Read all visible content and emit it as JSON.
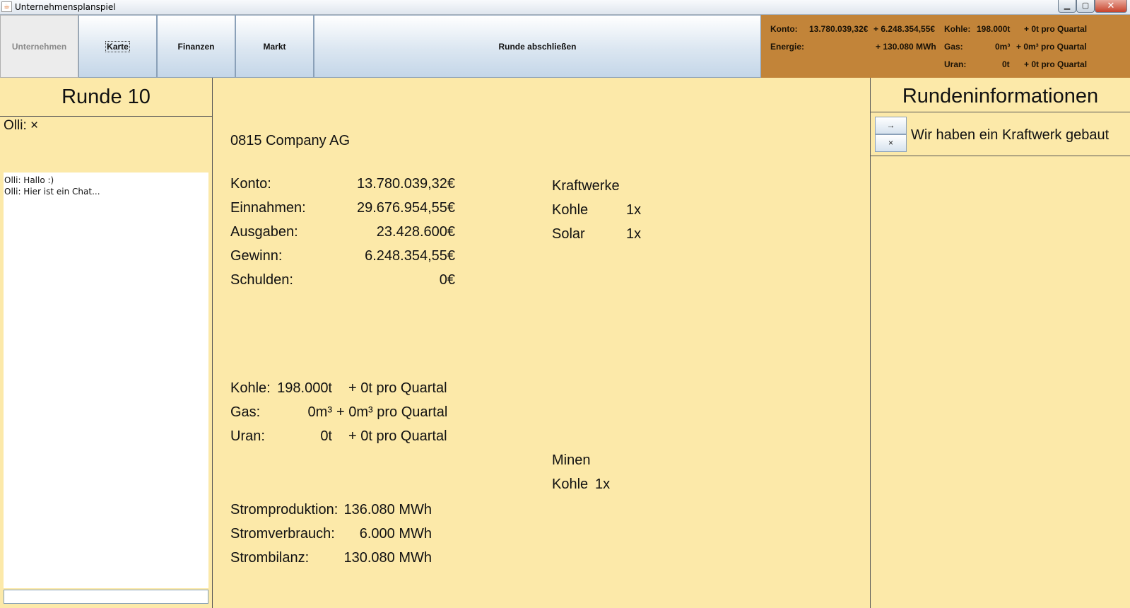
{
  "window": {
    "title": "Unternehmensplanspiel",
    "min_label": "▁",
    "max_label": "▢",
    "close_label": "✕"
  },
  "tabs": [
    {
      "label": "Unternehmen"
    },
    {
      "label": "Karte"
    },
    {
      "label": "Finanzen"
    },
    {
      "label": "Markt"
    }
  ],
  "end_round_label": "Runde abschließen",
  "status": {
    "konto_label": "Konto:",
    "konto_value": "13.780.039,32€",
    "konto_delta": "+ 6.248.354,55€",
    "energie_label": "Energie:",
    "energie_delta": "+ 130.080 MWh",
    "kohle_label": "Kohle:",
    "kohle_value": "198.000t",
    "kohle_rate": "+ 0t pro Quartal",
    "gas_label": "Gas:",
    "gas_value": "0m³",
    "gas_rate": "+ 0m³ pro Quartal",
    "uran_label": "Uran:",
    "uran_value": "0t",
    "uran_rate": "+ 0t pro Quartal"
  },
  "left": {
    "round_title": "Runde 10",
    "player": "Olli: ×",
    "chat": [
      "Olli: Hallo :)",
      "Olli: Hier ist ein Chat..."
    ],
    "chat_input_value": ""
  },
  "company": {
    "name": "0815 Company AG",
    "finance": [
      {
        "label": "Konto:",
        "value": "13.780.039,32€"
      },
      {
        "label": "Einnahmen:",
        "value": "29.676.954,55€"
      },
      {
        "label": "Ausgaben:",
        "value": "23.428.600€"
      },
      {
        "label": "Gewinn:",
        "value": "6.248.354,55€"
      },
      {
        "label": "Schulden:",
        "value": "0€"
      }
    ],
    "resources": [
      {
        "label": "Kohle:",
        "value": "198.000t",
        "rate": "+ 0t pro Quartal"
      },
      {
        "label": "Gas:",
        "value": "0m³",
        "rate": "+ 0m³ pro Quartal"
      },
      {
        "label": "Uran:",
        "value": "0t",
        "rate": "+ 0t pro Quartal"
      }
    ],
    "power": [
      {
        "label": "Stromproduktion:",
        "value": "136.080 MWh"
      },
      {
        "label": "Stromverbrauch:",
        "value": "6.000 MWh"
      },
      {
        "label": "Strombilanz:",
        "value": "130.080 MWh"
      }
    ],
    "plants_title": "Kraftwerke",
    "plants": [
      {
        "name": "Kohle",
        "count": "1x"
      },
      {
        "name": "Solar",
        "count": "1x"
      }
    ],
    "mines_title": "Minen",
    "mines": [
      {
        "name": "Kohle",
        "count": "1x"
      }
    ]
  },
  "right": {
    "title": "Rundeninformationen",
    "open_label": "→",
    "dismiss_label": "×",
    "message": "Wir haben ein Kraftwerk gebaut"
  }
}
